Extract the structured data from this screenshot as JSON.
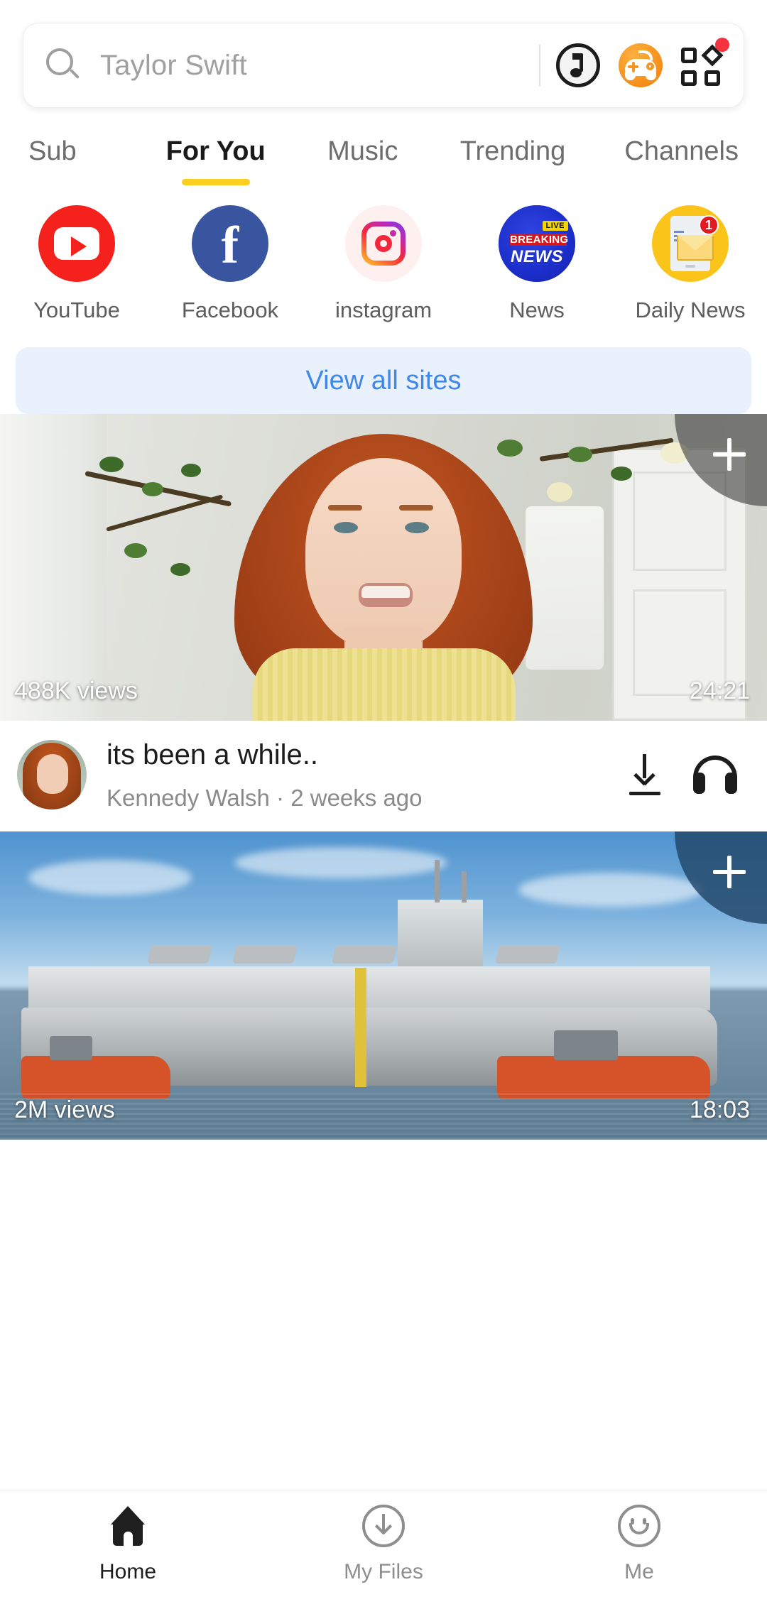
{
  "search": {
    "placeholder": "Taylor Swift",
    "value": "",
    "icon": "search-icon",
    "actions": [
      {
        "name": "music-icon",
        "label": "Music"
      },
      {
        "name": "game-icon",
        "label": "Games"
      },
      {
        "name": "apps-grid-icon",
        "label": "Apps",
        "badge": true
      }
    ]
  },
  "tabs": [
    {
      "label": "Sub",
      "active": false
    },
    {
      "label": "For You",
      "active": true
    },
    {
      "label": "Music",
      "active": false
    },
    {
      "label": "Trending",
      "active": false
    },
    {
      "label": "Channels",
      "active": false
    }
  ],
  "shortcuts": [
    {
      "label": "YouTube",
      "icon": "youtube-icon"
    },
    {
      "label": "Facebook",
      "icon": "facebook-icon"
    },
    {
      "label": "instagram",
      "icon": "instagram-icon"
    },
    {
      "label": "News",
      "icon": "breaking-news-icon",
      "badges": {
        "live": "LIVE",
        "breaking": "BREAKING",
        "news": "NEWS"
      }
    },
    {
      "label": "Daily News",
      "icon": "daily-news-icon",
      "badge_count": "1"
    }
  ],
  "view_all": {
    "label": "View all sites"
  },
  "feed": [
    {
      "views": "488K views",
      "duration": "24:21",
      "title": "its been a while..",
      "subtitle": "Kennedy Walsh · 2 weeks ago",
      "add_label": "+",
      "actions": [
        {
          "name": "download-icon",
          "label": "Download"
        },
        {
          "name": "headphones-icon",
          "label": "Audio"
        }
      ]
    },
    {
      "views": "2M views",
      "duration": "18:03",
      "add_label": "+"
    }
  ],
  "bottom_nav": [
    {
      "label": "Home",
      "icon": "home-icon",
      "active": true
    },
    {
      "label": "My Files",
      "icon": "download-circle-icon",
      "active": false
    },
    {
      "label": "Me",
      "icon": "smiley-icon",
      "active": false
    }
  ],
  "colors": {
    "accent_yellow": "#fcd021",
    "link_blue": "#3f87e8",
    "badge_red": "#f5333f",
    "youtube_red": "#f5211c",
    "facebook_blue": "#3a559f",
    "news_blue": "#1c2ecb",
    "daily_news_yellow": "#fbc41b"
  }
}
